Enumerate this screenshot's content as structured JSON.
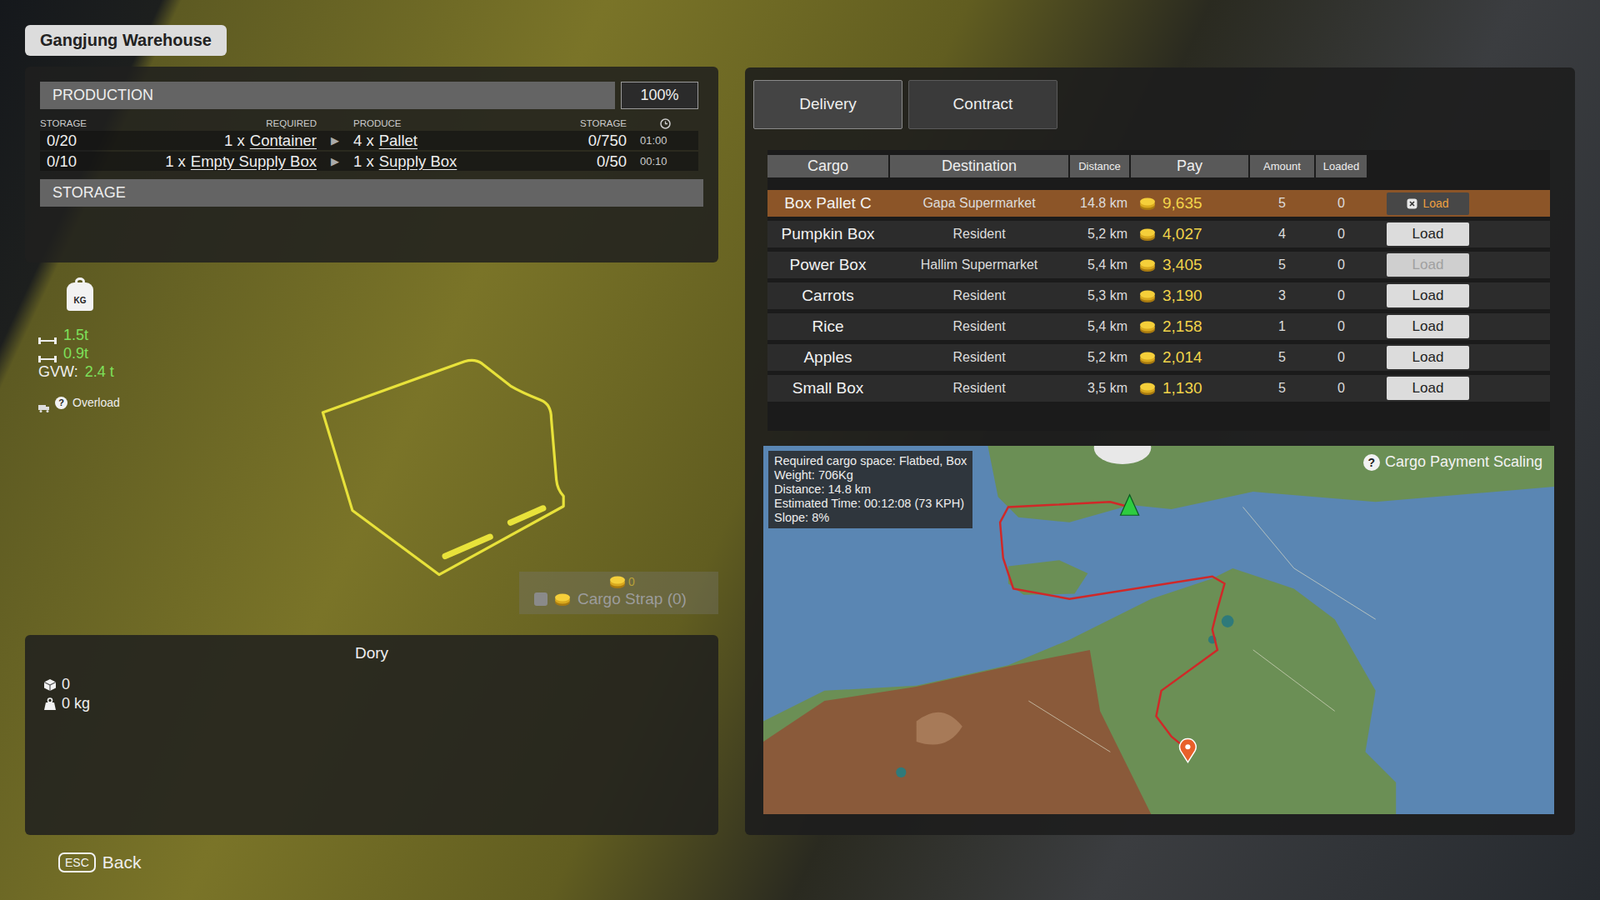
{
  "header": {
    "title": "Gangjung Warehouse"
  },
  "production": {
    "title": "PRODUCTION",
    "efficiency": "100%",
    "columns": {
      "storage_in": "STORAGE",
      "required": "REQUIRED",
      "produce": "PRODUCE",
      "storage_out": "STORAGE"
    },
    "rows": [
      {
        "storage_in": "0/20",
        "required_qty": "1 x",
        "required_item": "Container",
        "arrow": "▶",
        "produce_qty": "4 x",
        "produce_item": "Pallet",
        "storage_out": "0/750",
        "time": "01:00"
      },
      {
        "storage_in": "0/10",
        "required_qty": "1 x",
        "required_item": "Empty Supply Box",
        "arrow": "▶",
        "produce_qty": "1 x",
        "produce_item": "Supply Box",
        "storage_out": "0/50",
        "time": "00:10"
      }
    ]
  },
  "storage": {
    "title": "STORAGE"
  },
  "vehicle": {
    "weight_icon_label": "KG",
    "axles": [
      {
        "weight": "1.5t"
      },
      {
        "weight": "0.9t"
      }
    ],
    "gvw_label": "GVW:",
    "gvw": "2.4 t",
    "overload_icon": "?",
    "overload_label": "Overload",
    "name": "Dory",
    "cargo_count": "0",
    "cargo_weight": "0 kg"
  },
  "cargo_strap": {
    "price": "0",
    "label": "Cargo Strap (0)",
    "checked": false
  },
  "back": {
    "key": "ESC",
    "label": "Back"
  },
  "tabs": [
    {
      "label": "Delivery",
      "selected": true
    },
    {
      "label": "Contract",
      "selected": false
    }
  ],
  "table": {
    "columns": [
      "Cargo",
      "Destination",
      "Distance",
      "Pay",
      "Amount",
      "Loaded"
    ],
    "rows": [
      {
        "cargo": "Box Pallet C",
        "destination": "Gapa Supermarket",
        "distance": "14.8 km",
        "pay": "9,635",
        "amount": "5",
        "loaded": "0",
        "action": "Load",
        "selected": true,
        "disabled": false
      },
      {
        "cargo": "Pumpkin Box",
        "destination": "Resident",
        "distance": "5,2 km",
        "pay": "4,027",
        "amount": "4",
        "loaded": "0",
        "action": "Load",
        "selected": false,
        "disabled": false
      },
      {
        "cargo": "Power Box",
        "destination": "Hallim Supermarket",
        "distance": "5,4 km",
        "pay": "3,405",
        "amount": "5",
        "loaded": "0",
        "action": "Load",
        "selected": false,
        "disabled": true
      },
      {
        "cargo": "Carrots",
        "destination": "Resident",
        "distance": "5,3 km",
        "pay": "3,190",
        "amount": "3",
        "loaded": "0",
        "action": "Load",
        "selected": false,
        "disabled": false
      },
      {
        "cargo": "Rice",
        "destination": "Resident",
        "distance": "5,4 km",
        "pay": "2,158",
        "amount": "1",
        "loaded": "0",
        "action": "Load",
        "selected": false,
        "disabled": false
      },
      {
        "cargo": "Apples",
        "destination": "Resident",
        "distance": "5,2 km",
        "pay": "2,014",
        "amount": "5",
        "loaded": "0",
        "action": "Load",
        "selected": false,
        "disabled": false
      },
      {
        "cargo": "Small Box",
        "destination": "Resident",
        "distance": "3,5 km",
        "pay": "1,130",
        "amount": "5",
        "loaded": "0",
        "action": "Load",
        "selected": false,
        "disabled": false
      }
    ]
  },
  "map": {
    "info": [
      "Required cargo space: Flatbed, Box",
      "Weight: 706Kg",
      "Distance: 14.8 km",
      "Estimated Time: 00:12:08 (73 KPH)",
      "Slope: 8%"
    ],
    "scaling_icon": "?",
    "scaling_label": "Cargo Payment Scaling"
  }
}
